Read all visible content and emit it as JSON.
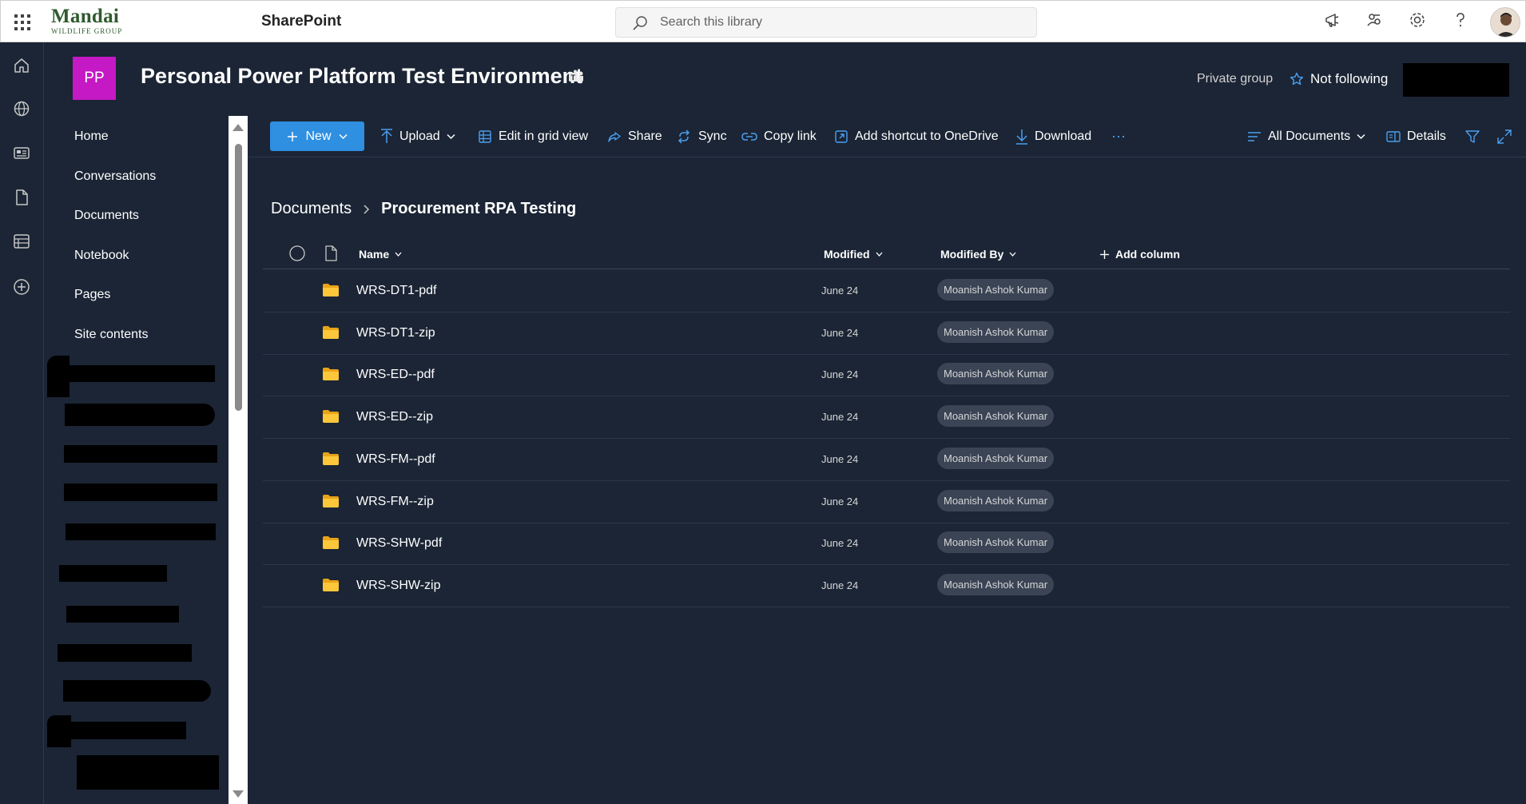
{
  "suite": {
    "logo_main": "Mandai",
    "logo_sub": "WILDLIFE GROUP",
    "app_name": "SharePoint",
    "search_placeholder": "Search this library"
  },
  "site": {
    "initials": "PP",
    "title": "Personal Power Platform Test Environment",
    "privacy": "Private group",
    "follow_label": "Not following",
    "accent": "#c419c4"
  },
  "nav": {
    "items": [
      "Home",
      "Conversations",
      "Documents",
      "Notebook",
      "Pages",
      "Site contents"
    ]
  },
  "commands": {
    "new": "New",
    "upload": "Upload",
    "grid": "Edit in grid view",
    "share": "Share",
    "sync": "Sync",
    "copy_link": "Copy link",
    "shortcut": "Add shortcut to OneDrive",
    "download": "Download",
    "more": "⋯",
    "view": "All Documents",
    "details": "Details"
  },
  "breadcrumb": {
    "root": "Documents",
    "current": "Procurement RPA Testing"
  },
  "columns": {
    "name": "Name",
    "modified": "Modified",
    "modified_by": "Modified By",
    "add_column": "Add column"
  },
  "rows": [
    {
      "name": "WRS-DT1-pdf",
      "modified": "June 24",
      "by": "Moanish Ashok Kumar"
    },
    {
      "name": "WRS-DT1-zip",
      "modified": "June 24",
      "by": "Moanish Ashok Kumar"
    },
    {
      "name": "WRS-ED--pdf",
      "modified": "June 24",
      "by": "Moanish Ashok Kumar"
    },
    {
      "name": "WRS-ED--zip",
      "modified": "June 24",
      "by": "Moanish Ashok Kumar"
    },
    {
      "name": "WRS-FM--pdf",
      "modified": "June 24",
      "by": "Moanish Ashok Kumar"
    },
    {
      "name": "WRS-FM--zip",
      "modified": "June 24",
      "by": "Moanish Ashok Kumar"
    },
    {
      "name": "WRS-SHW-pdf",
      "modified": "June 24",
      "by": "Moanish Ashok Kumar"
    },
    {
      "name": "WRS-SHW-zip",
      "modified": "June 24",
      "by": "Moanish Ashok Kumar"
    }
  ]
}
